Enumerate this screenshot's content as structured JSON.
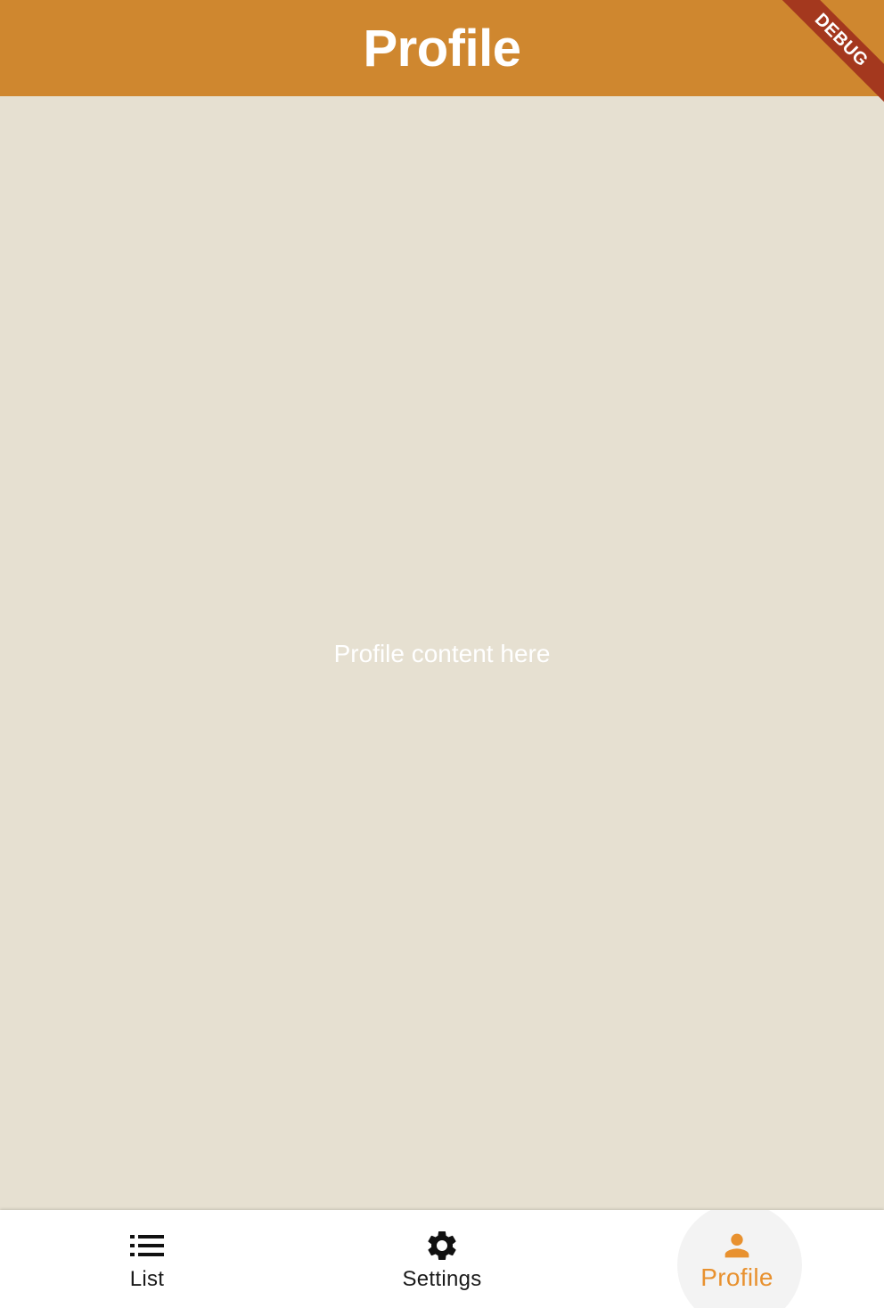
{
  "app_bar": {
    "title": "Profile"
  },
  "debug_banner": {
    "label": "DEBUG"
  },
  "content": {
    "text": "Profile content here"
  },
  "bottom_nav": {
    "items": [
      {
        "label": "List",
        "icon": "list-icon",
        "selected": false
      },
      {
        "label": "Settings",
        "icon": "gear-icon",
        "selected": false
      },
      {
        "label": "Profile",
        "icon": "person-icon",
        "selected": true
      }
    ]
  },
  "colors": {
    "app_bar": "#CF872F",
    "background": "#E6E0D1",
    "accent": "#E8912F",
    "debug_banner": "#A4381E"
  }
}
